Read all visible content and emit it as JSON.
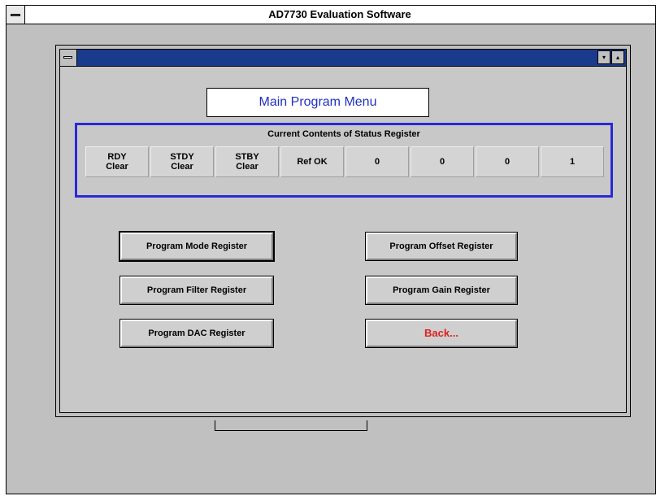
{
  "app": {
    "title": "AD7730 Evaluation Software",
    "sysmenu_icon": "system-menu-icon"
  },
  "child_window": {
    "title": "",
    "minimize_icon": "▾",
    "maximize_icon": "▴"
  },
  "main_menu": {
    "title": "Main Program Menu"
  },
  "status_register": {
    "heading": "Current Contents of Status Register",
    "cells": [
      {
        "line1": "RDY",
        "line2": "Clear"
      },
      {
        "line1": "STDY",
        "line2": "Clear"
      },
      {
        "line1": "STBY",
        "line2": "Clear"
      },
      {
        "line1": "Ref OK",
        "line2": ""
      },
      {
        "line1": "0",
        "line2": ""
      },
      {
        "line1": "0",
        "line2": ""
      },
      {
        "line1": "0",
        "line2": ""
      },
      {
        "line1": "1",
        "line2": ""
      }
    ]
  },
  "buttons": {
    "program_mode": "Program Mode Register",
    "program_filter": "Program Filter Register",
    "program_dac": "Program DAC Register",
    "program_offset": "Program Offset Register",
    "program_gain": "Program Gain Register",
    "back": "Back..."
  },
  "colors": {
    "titlebar_active": "#1a3a8c",
    "status_border": "#2a2ad8",
    "menu_title_text": "#2030c0",
    "back_text": "#e02020"
  }
}
